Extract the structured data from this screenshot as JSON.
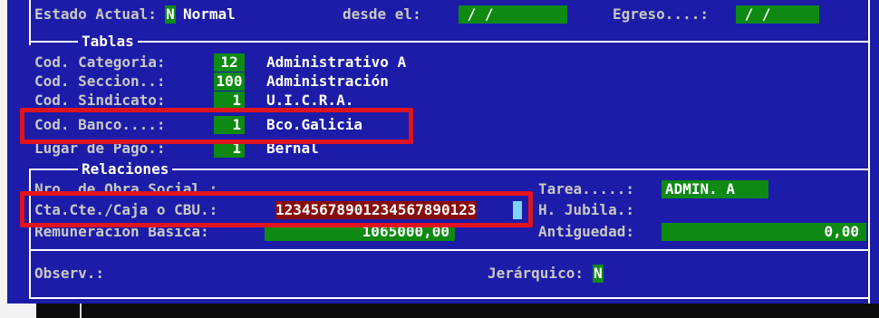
{
  "header": {
    "estado_label": "Estado Actual:",
    "estado_code": "N",
    "estado_value": "Normal",
    "desde_label": "desde el:",
    "desde_value": " / /",
    "egreso_label": "Egreso....:",
    "egreso_value": " / /"
  },
  "tablas": {
    "title": "Tablas",
    "categoria": {
      "label": "Cod. Categoria:",
      "code": "12",
      "desc": "Administrativo A"
    },
    "seccion": {
      "label": "Cod. Seccion..:",
      "code": "100",
      "desc": "Administración"
    },
    "sindicato": {
      "label": "Cod. Sindicato:",
      "code": "1",
      "desc": "U.I.C.R.A."
    },
    "banco": {
      "label": "Cod. Banco....:",
      "code": "1",
      "desc": "Bco.Galicia"
    },
    "lugar": {
      "label": "Lugar de Pago.:",
      "code": "1",
      "desc": "Bernal"
    }
  },
  "relaciones": {
    "title": "Relaciones",
    "obra_social_label": "Nro. de Obra Social.:",
    "cbu_label": "Cta.Cte./Caja o CBU.:",
    "cbu_value": "12345678901234567890123",
    "remuneracion_label": "Remuneracion Basica:",
    "remuneracion_value": "1065000,00",
    "tarea_label": "Tarea.....:",
    "tarea_value": "ADMIN. A",
    "jubila_label": "H. Jubila.:",
    "antiguedad_label": "Antiguedad:",
    "antiguedad_value": "0,00"
  },
  "footer": {
    "observ_label": "Observ.:",
    "jerarquico_label": "Jerárquico:",
    "jerarquico_value": "N"
  },
  "colors": {
    "background": "#1c1ca8",
    "field": "#0e8a12",
    "highlight_box": "#e0141e",
    "cbu_field": "#8a0d0d",
    "cursor": "#7fd4f6"
  }
}
